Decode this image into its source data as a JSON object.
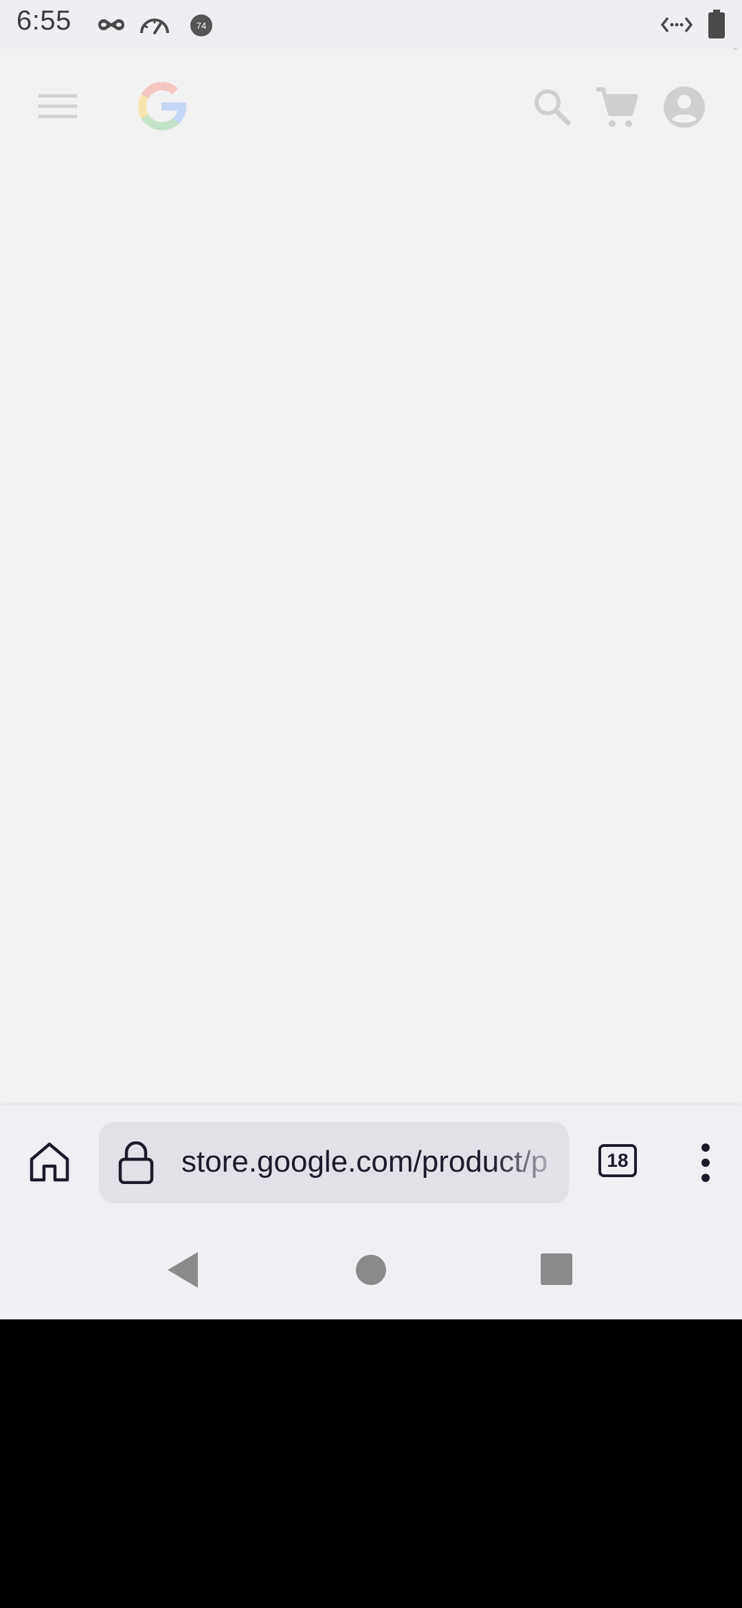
{
  "status_bar": {
    "time": "6:55",
    "notification_icons": [
      "incognito-icon",
      "speedometer-icon",
      "badge-74-icon"
    ],
    "badge_text": "74",
    "system_icons": [
      "data-saver-icon",
      "battery-icon"
    ]
  },
  "web_header": {
    "icons": [
      "menu-icon",
      "google-logo",
      "search-icon",
      "cart-icon",
      "account-icon"
    ]
  },
  "toolbar": {
    "url": "store.google.com/product/p",
    "tab_count": "18"
  },
  "nav_bar": {
    "buttons": [
      "back-button",
      "home-button",
      "recents-button"
    ]
  },
  "colors": {
    "page_background": "#f2f2f2",
    "toolbar_background": "#efeff4",
    "url_bar_background": "#e2e1e8",
    "toolbar_ink": "#1d1b2b",
    "header_icon_gray": "#cfcfcf"
  }
}
